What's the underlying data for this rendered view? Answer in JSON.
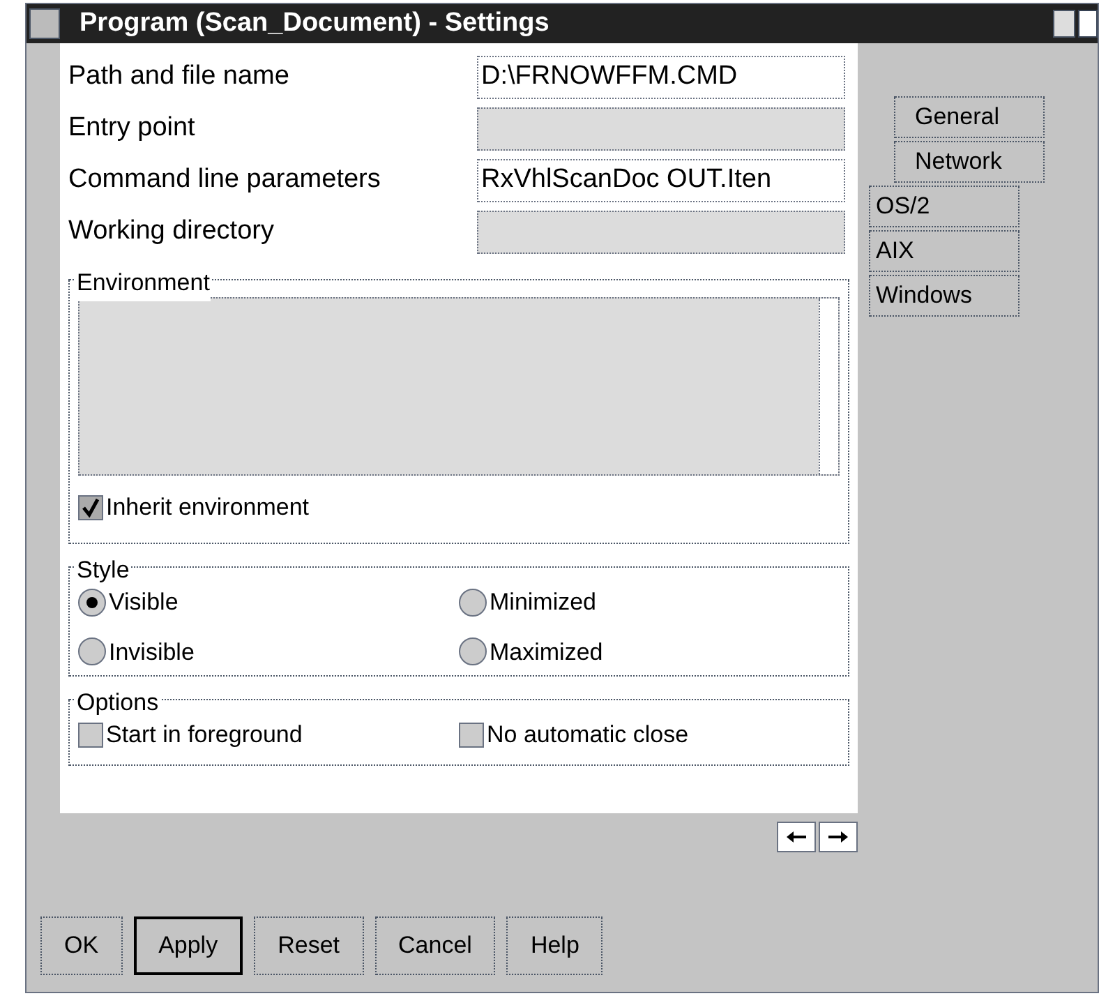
{
  "window": {
    "title": "Program (Scan_Document) - Settings"
  },
  "fields": [
    {
      "label": "Path and file name",
      "value": "D:\\FRNOWFFM.CMD"
    },
    {
      "label": "Entry point"
    },
    {
      "label": "Command line parameters",
      "value": "RxVhlScanDoc OUT.Iten"
    },
    {
      "label": "Working directory"
    }
  ],
  "environment": {
    "title": "Environment",
    "inherit": {
      "label": "Inherit environment",
      "checked": true
    }
  },
  "style": {
    "title": "Style",
    "options": [
      {
        "label": "Visible",
        "selected": true
      },
      {
        "label": "Minimized",
        "selected": false
      },
      {
        "label": "Invisible",
        "selected": false
      },
      {
        "label": "Maximized",
        "selected": false
      }
    ]
  },
  "options": {
    "title": "Options",
    "items": [
      {
        "label": "Start in foreground",
        "checked": false
      },
      {
        "label": "No automatic close",
        "checked": false
      }
    ]
  },
  "tabs": [
    {
      "label": "General",
      "kind": "major",
      "selected": false
    },
    {
      "label": "Network",
      "kind": "major",
      "selected": false
    },
    {
      "label": "OS/2",
      "kind": "minor",
      "selected": false
    },
    {
      "label": "AIX",
      "kind": "minor",
      "selected": false
    },
    {
      "label": "Windows",
      "kind": "minor",
      "selected": false
    }
  ],
  "buttons": [
    {
      "label": "OK",
      "selected": false
    },
    {
      "label": "Apply",
      "selected": true
    },
    {
      "label": "Reset",
      "selected": false
    },
    {
      "label": "Cancel",
      "selected": false
    },
    {
      "label": "Help",
      "selected": false
    }
  ]
}
